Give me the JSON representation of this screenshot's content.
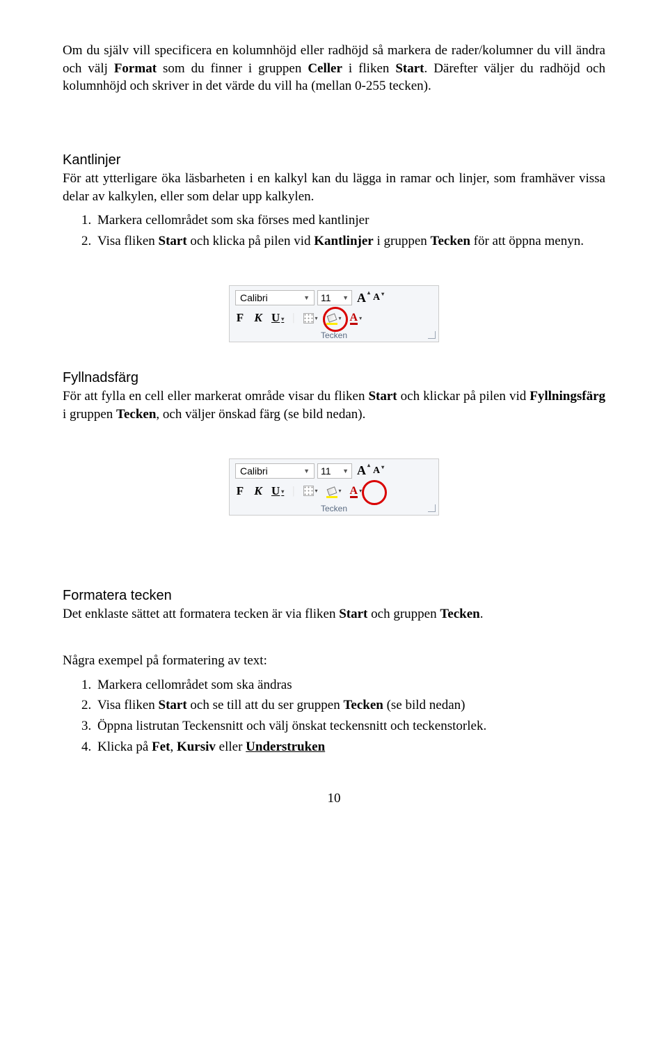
{
  "intro": {
    "p1a": "Om du själv vill specificera en kolumnhöjd eller radhöjd så markera de rader/kolumner du vill ändra och välj ",
    "format": "Format",
    "p1b": " som du finner i gruppen ",
    "celler": "Celler",
    "p1c": " i fliken ",
    "start": "Start",
    "p1d": ". Därefter väljer du radhöjd och kolumnhöjd och skriver in det värde du vill ha (mellan 0-255 tecken)."
  },
  "kantlinjer": {
    "title": "Kantlinjer",
    "desc": "För att ytterligare öka läsbarheten i en kalkyl kan du lägga in ramar och linjer, som framhäver vissa delar av kalkylen, eller som delar upp kalkylen.",
    "steps": {
      "1": "Markera cellområdet som ska förses med kantlinjer",
      "2a": "Visa fliken ",
      "2_start": "Start",
      "2b": " och klicka på pilen vid ",
      "2_kantlinjer": "Kantlinjer",
      "2c": " i gruppen ",
      "2_tecken": "Tecken",
      "2d": " för att öppna menyn."
    }
  },
  "fyllnadsfarg": {
    "title": "Fyllnadsfärg",
    "desc_a": "För att fylla en cell eller markerat område visar du fliken ",
    "start": "Start",
    "desc_b": " och klickar på pilen vid ",
    "fyllningsfarg": "Fyllningsfärg",
    "desc_c": " i gruppen ",
    "tecken": "Tecken",
    "desc_d": ", och väljer önskad färg (se bild nedan)."
  },
  "formatera": {
    "title": "Formatera tecken",
    "desc_a": "Det enklaste sättet att formatera tecken är via fliken ",
    "start": "Start",
    "desc_b": " och gruppen ",
    "tecken": "Tecken",
    "desc_c": "."
  },
  "exempel": {
    "intro": "Några exempel på formatering av text:",
    "steps": {
      "1": "Markera cellområdet som ska ändras",
      "2a": "Visa fliken ",
      "2_start": "Start",
      "2b": " och se till att du ser gruppen ",
      "2_tecken": "Tecken",
      "2c": " (se bild nedan)",
      "3": "Öppna listrutan Teckensnitt och välj önskat teckensnitt och teckenstorlek.",
      "4a": "Klicka på ",
      "4_fet": "Fet",
      "4b": ", ",
      "4_kursiv": "Kursiv",
      "4c": " eller ",
      "4_under": "Understruken"
    }
  },
  "ribbon": {
    "font_name": "Calibri",
    "font_size": "11",
    "bold": "F",
    "italic": "K",
    "underline": "U",
    "group_label": "Tecken"
  },
  "page_number": "10"
}
